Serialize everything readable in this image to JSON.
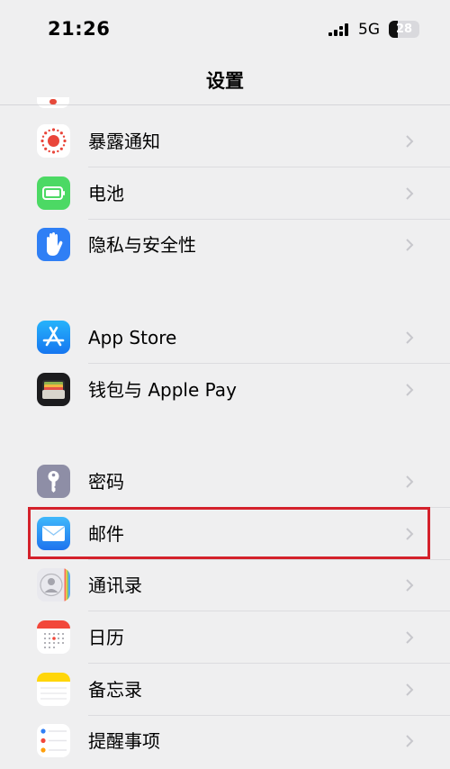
{
  "status_bar": {
    "time": "21:26",
    "network": "5G",
    "battery_level": "28",
    "signal_icon": "cellular-signal-icon"
  },
  "nav": {
    "title": "设置"
  },
  "colors": {
    "background": "#efeff0",
    "highlight": "#d4212b",
    "chevron": "#c7c7cc"
  },
  "groups": [
    {
      "items": [
        {
          "label": "暴露通知",
          "icon": "exposure-notification-icon",
          "icon_color": "#ffffff"
        },
        {
          "label": "电池",
          "icon": "battery-icon",
          "icon_color": "#4cd964"
        },
        {
          "label": "隐私与安全性",
          "icon": "privacy-hand-icon",
          "icon_color": "#2f7ff5"
        }
      ]
    },
    {
      "items": [
        {
          "label": "App Store",
          "icon": "app-store-icon",
          "icon_color": "#1c8ef9"
        },
        {
          "label": "钱包与 Apple Pay",
          "icon": "wallet-icon",
          "icon_color": "#1c1c1e"
        }
      ]
    },
    {
      "items": [
        {
          "label": "密码",
          "icon": "key-icon",
          "icon_color": "#8e8ea6"
        },
        {
          "label": "邮件",
          "icon": "mail-icon",
          "icon_color": "#2b8ff3",
          "highlighted": true
        },
        {
          "label": "通讯录",
          "icon": "contacts-icon",
          "icon_color": "#e5e5ea"
        },
        {
          "label": "日历",
          "icon": "calendar-icon",
          "icon_color": "#ffffff"
        },
        {
          "label": "备忘录",
          "icon": "notes-icon",
          "icon_color": "#ffd60a"
        },
        {
          "label": "提醒事项",
          "icon": "reminders-icon",
          "icon_color": "#ffffff"
        }
      ]
    }
  ]
}
